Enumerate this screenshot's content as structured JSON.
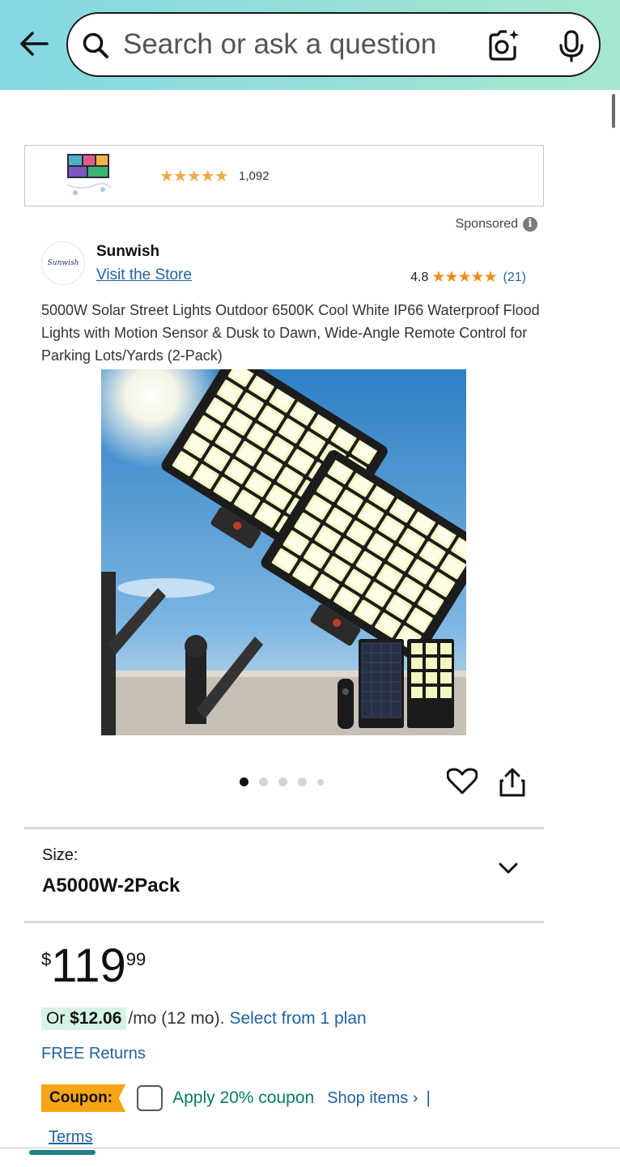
{
  "search": {
    "placeholder": "Search or ask a question"
  },
  "ad": {
    "rating_stars": "★★★★★",
    "review_count": "1,092"
  },
  "sponsored_label": "Sponsored",
  "brand": {
    "logo_text": "Sunwish",
    "name": "Sunwish",
    "visit_store": "Visit the Store",
    "rating": "4.8",
    "stars": "★★★★★",
    "count": "(21)"
  },
  "product": {
    "title": "5000W Solar Street Lights Outdoor 6500K Cool White IP66 Waterproof Flood Lights with Motion Sensor & Dusk to Dawn, Wide-Angle Remote Control for Parking Lots/Yards (2-Pack)",
    "image_count": 5,
    "active_image": 1
  },
  "size": {
    "label": "Size:",
    "value": "A5000W-2Pack"
  },
  "price": {
    "symbol": "$",
    "whole": "119",
    "fraction": "99"
  },
  "installment": {
    "prefix": "Or ",
    "amount": "$12.06",
    "suffix": "/mo (12 mo).",
    "plan_link": "Select from 1 plan"
  },
  "free_returns": "FREE Returns",
  "coupon": {
    "tag": "Coupon:",
    "apply": "Apply 20% coupon",
    "shop": "Shop items ›",
    "separator": "|",
    "terms": "Terms"
  },
  "colors": {
    "link": "#2162a1",
    "coupon_tag": "#f7a417",
    "coupon_green": "#067d62",
    "star": "#f08c1a"
  }
}
